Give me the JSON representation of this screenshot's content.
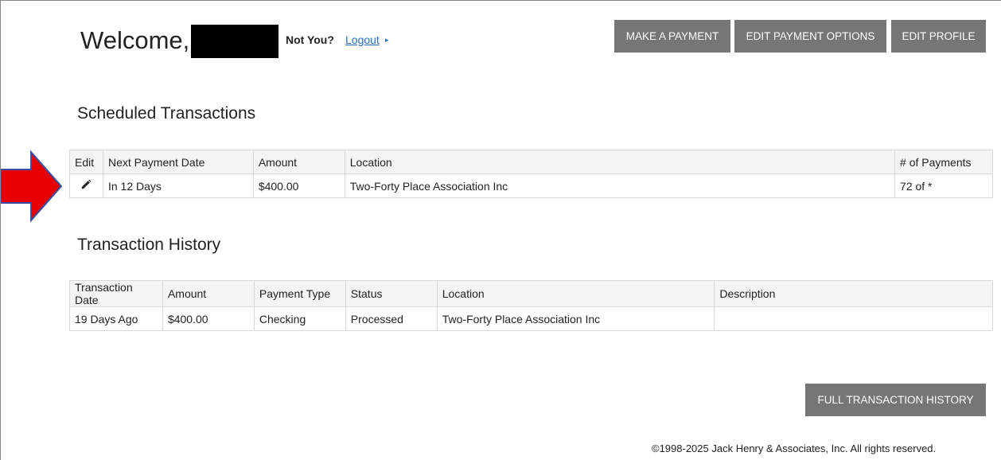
{
  "header": {
    "welcome_text": "Welcome,",
    "not_you": "Not You?",
    "logout": "Logout",
    "logout_caret": "▸"
  },
  "actions": {
    "make_payment": "MAKE A PAYMENT",
    "edit_payment_options": "EDIT PAYMENT OPTIONS",
    "edit_profile": "EDIT PROFILE",
    "full_history": "FULL TRANSACTION HISTORY"
  },
  "scheduled": {
    "title": "Scheduled Transactions",
    "headers": [
      "Edit",
      "Next Payment Date",
      "Amount",
      "Location",
      "# of Payments"
    ],
    "rows": [
      {
        "next_date": "In 12 Days",
        "amount": "$400.00",
        "location": "Two-Forty Place Association Inc",
        "payments": "72 of *"
      }
    ]
  },
  "history": {
    "title": "Transaction History",
    "headers": [
      "Transaction Date",
      "Amount",
      "Payment Type",
      "Status",
      "Location",
      "Description"
    ],
    "rows": [
      {
        "date": "19 Days Ago",
        "amount": "$400.00",
        "type": "Checking",
        "status": "Processed",
        "location": "Two-Forty Place Association Inc",
        "description": ""
      }
    ]
  },
  "footer": {
    "copyright": "©1998-2025 Jack Henry & Associates, Inc. All rights reserved."
  },
  "colors": {
    "button_bg": "#767676",
    "link": "#2a6ebb",
    "annotation_arrow_fill": "#e60000",
    "annotation_arrow_stroke": "#3a4fa0"
  },
  "icons": {
    "edit": "pencil-icon",
    "annotation": "red-arrow"
  }
}
